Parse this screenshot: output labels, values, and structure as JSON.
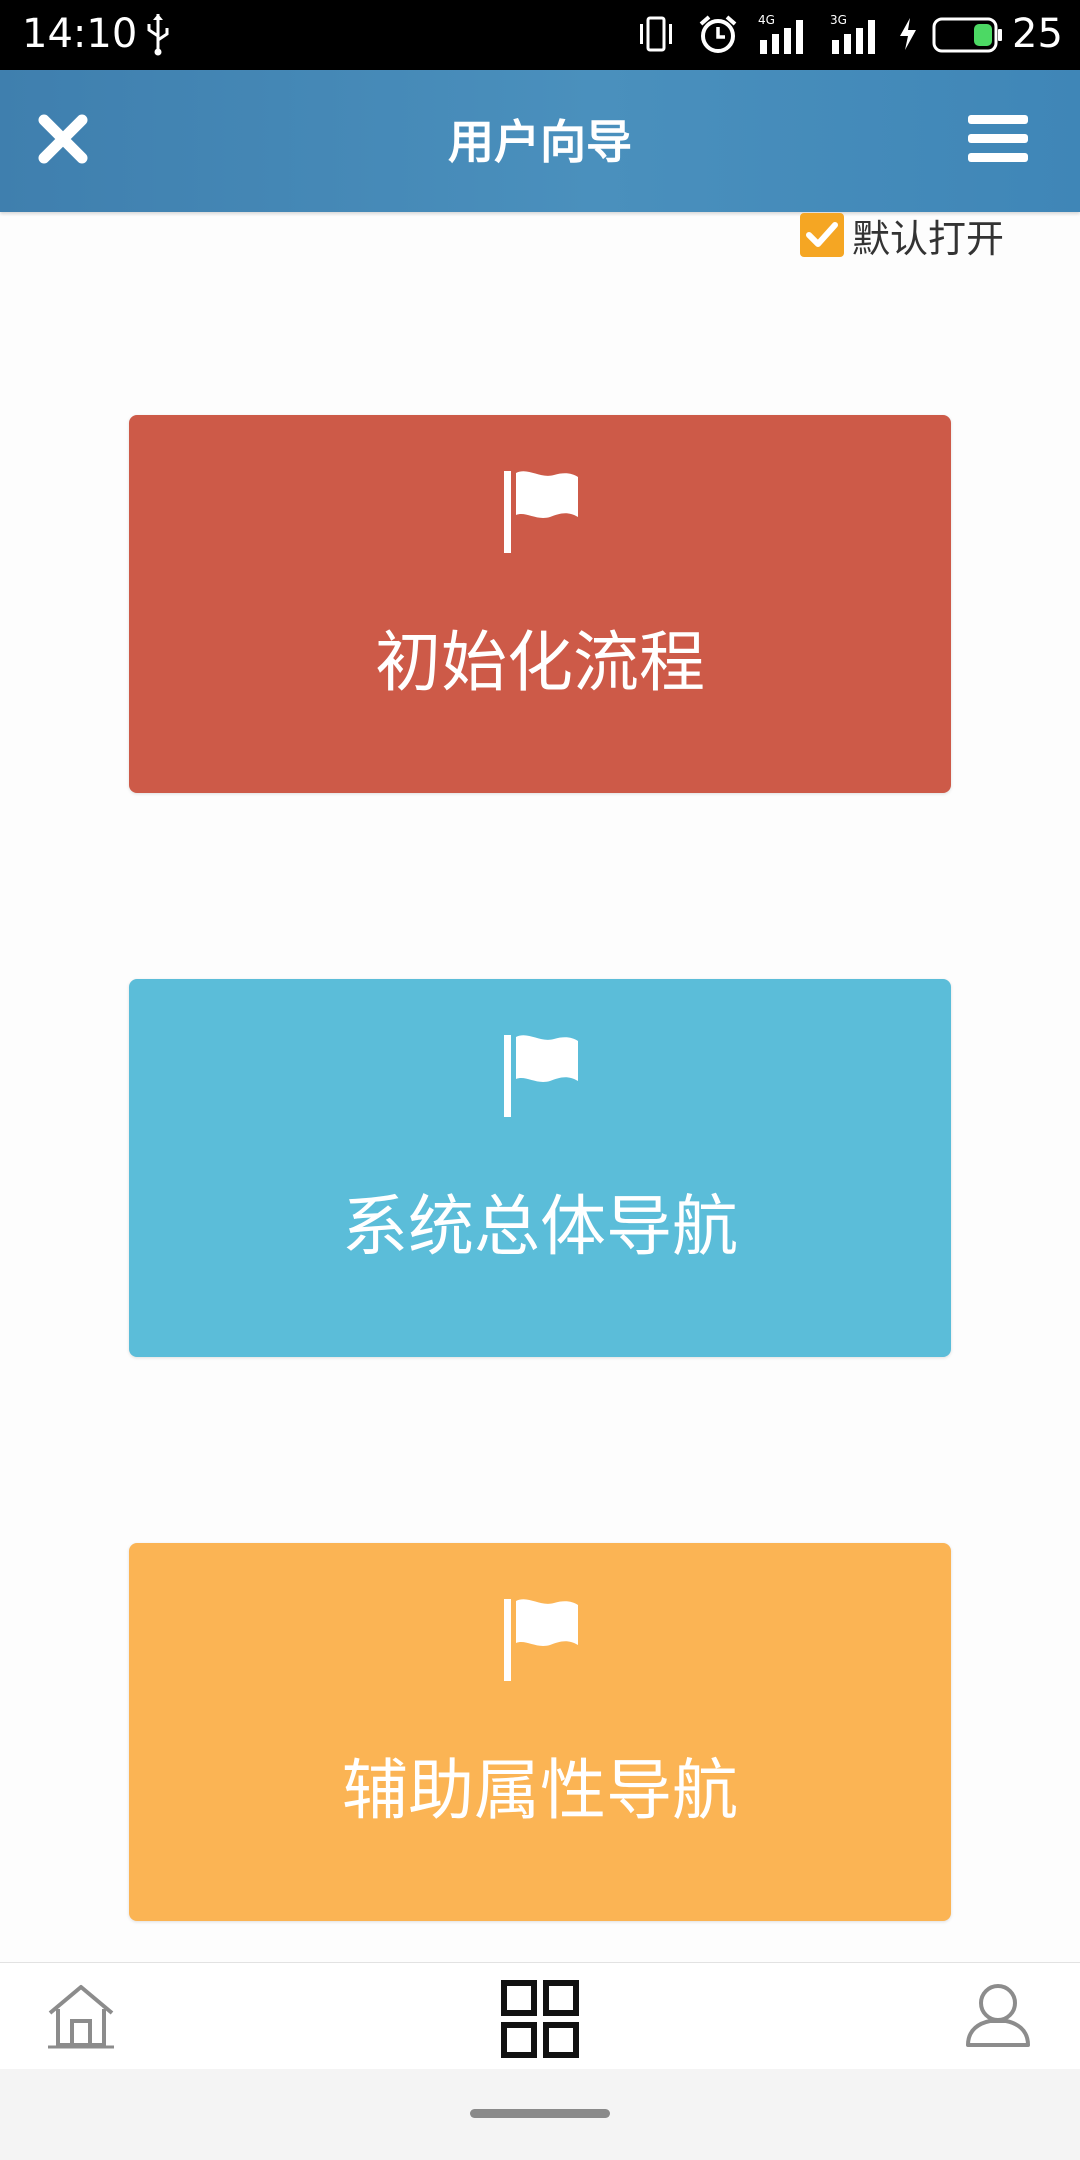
{
  "status_bar": {
    "time": "14:10",
    "network_4g": "4G",
    "network_3g": "3G",
    "battery_level": "25"
  },
  "header": {
    "title": "用户向导",
    "close_icon": "close-icon",
    "menu_icon": "hamburger-menu-icon"
  },
  "default_open": {
    "label": "默认打开",
    "checked": true,
    "check_color": "#f5a623"
  },
  "cards": [
    {
      "label": "初始化流程",
      "icon": "flag-icon",
      "color": "#cd5a48"
    },
    {
      "label": "系统总体导航",
      "icon": "flag-icon",
      "color": "#5bbdd9"
    },
    {
      "label": "辅助属性导航",
      "icon": "flag-icon",
      "color": "#fbb454"
    }
  ],
  "bottom_nav": {
    "items": [
      {
        "icon": "home-icon",
        "active": false
      },
      {
        "icon": "grid-icon",
        "active": true
      },
      {
        "icon": "user-icon",
        "active": false
      }
    ]
  },
  "colors": {
    "header": "#4a90bd",
    "status_bar": "#000000"
  }
}
